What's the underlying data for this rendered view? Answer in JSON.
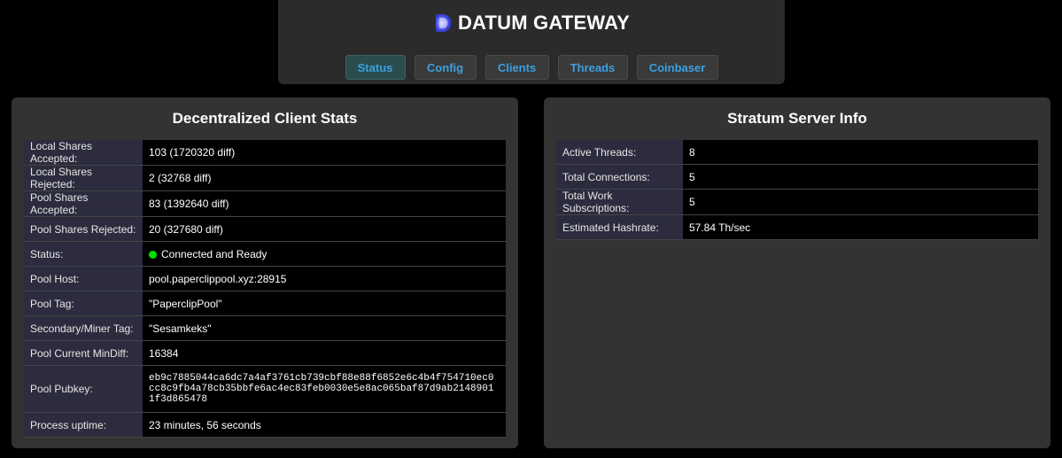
{
  "header": {
    "title": "DATUM GATEWAY",
    "logo_icon": "datum-logo-icon"
  },
  "nav": {
    "items": [
      {
        "label": "Status",
        "active": true
      },
      {
        "label": "Config",
        "active": false
      },
      {
        "label": "Clients",
        "active": false
      },
      {
        "label": "Threads",
        "active": false
      },
      {
        "label": "Coinbaser",
        "active": false
      }
    ]
  },
  "client_stats": {
    "title": "Decentralized Client Stats",
    "rows": [
      {
        "label": "Local Shares Accepted:",
        "value": "103 (1720320 diff)"
      },
      {
        "label": "Local Shares Rejected:",
        "value": "2 (32768 diff)"
      },
      {
        "label": "Pool Shares Accepted:",
        "value": "83 (1392640 diff)"
      },
      {
        "label": "Pool Shares Rejected:",
        "value": "20 (327680 diff)"
      },
      {
        "label": "Status:",
        "value": "Connected and Ready",
        "status_color": "#00e000"
      },
      {
        "label": "Pool Host:",
        "value": "pool.paperclippool.xyz:28915"
      },
      {
        "label": "Pool Tag:",
        "value": "\"PaperclipPool\""
      },
      {
        "label": "Secondary/Miner Tag:",
        "value": "\"Sesamkeks\""
      },
      {
        "label": "Pool Current MinDiff:",
        "value": "16384"
      },
      {
        "label": "Pool Pubkey:",
        "value": "eb9c7885044ca6dc7a4af3761cb739cbf88e88f6852e6c4b4f754710ec0cc8c9fb4a78cb35bbfe6ac4ec83feb0030e5e8ac065baf87d9ab21489011f3d865478"
      },
      {
        "label": "Process uptime:",
        "value": "23 minutes, 56 seconds"
      }
    ]
  },
  "stratum_info": {
    "title": "Stratum Server Info",
    "rows": [
      {
        "label": "Active Threads:",
        "value": "8"
      },
      {
        "label": "Total Connections:",
        "value": "5"
      },
      {
        "label": "Total Work Subscriptions:",
        "value": "5"
      },
      {
        "label": "Estimated Hashrate:",
        "value": "57.84 Th/sec"
      }
    ]
  },
  "colors": {
    "background": "#000000",
    "panel": "#333333",
    "label_cell": "#2c2c3e",
    "nav_text": "#3aa0e0",
    "nav_active": "#2b4d4f",
    "status_ok": "#00e000"
  }
}
